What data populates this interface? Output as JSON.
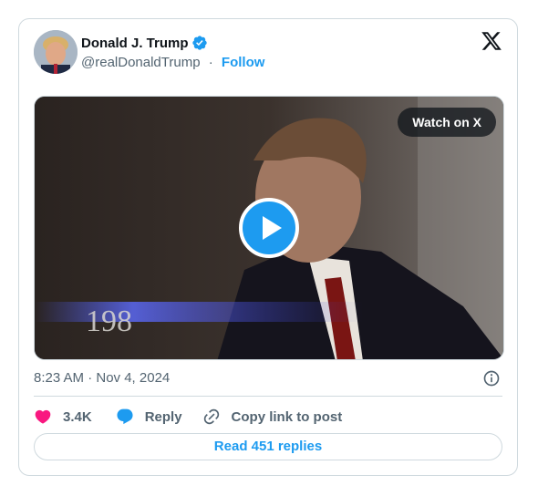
{
  "author": {
    "name": "Donald J. Trump",
    "handle": "@realDonaldTrump",
    "separator": "·",
    "follow_label": "Follow",
    "verified_color": "#1d9bf0",
    "avatar_icon": "avatar-photo"
  },
  "media": {
    "watch_label": "Watch on X",
    "overlay_text": "198",
    "play_icon": "play-icon"
  },
  "meta": {
    "timestamp": "8:23 AM · Nov 4, 2024",
    "info_icon": "info-icon"
  },
  "actions": {
    "likes_count": "3.4K",
    "reply_label": "Reply",
    "copy_label": "Copy link to post",
    "like_color": "#f91880",
    "reply_color": "#1d9bf0"
  },
  "footer": {
    "read_replies_label": "Read 451 replies"
  },
  "colors": {
    "accent": "#1d9bf0",
    "muted": "#536471",
    "border": "#cfd9de"
  }
}
